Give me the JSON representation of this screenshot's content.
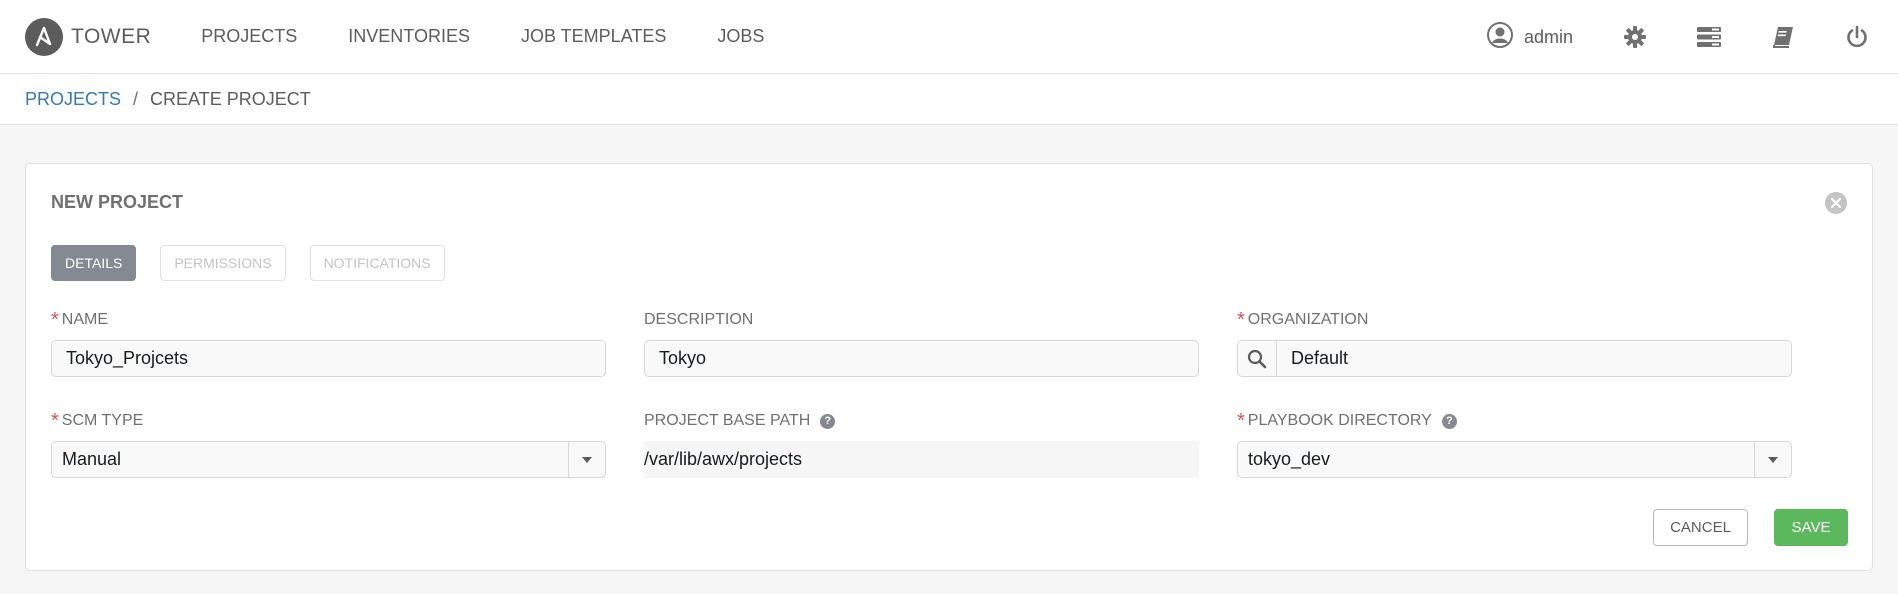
{
  "brand": {
    "name": "TOWER"
  },
  "nav": {
    "links": [
      "PROJECTS",
      "INVENTORIES",
      "JOB TEMPLATES",
      "JOBS"
    ],
    "user": "admin",
    "icons": [
      "settings-gear-icon",
      "server-list-icon",
      "book-icon",
      "power-icon"
    ]
  },
  "breadcrumb": {
    "parent": "PROJECTS",
    "separator": "/",
    "current": "CREATE PROJECT"
  },
  "panel": {
    "title": "NEW PROJECT",
    "tabs": [
      "DETAILS",
      "PERMISSIONS",
      "NOTIFICATIONS"
    ],
    "active_tab": "DETAILS"
  },
  "form": {
    "name": {
      "label": "NAME",
      "required": true,
      "value": "Tokyo_Projcets"
    },
    "description": {
      "label": "DESCRIPTION",
      "required": false,
      "value": "Tokyo"
    },
    "organization": {
      "label": "ORGANIZATION",
      "required": true,
      "value": "Default"
    },
    "scm_type": {
      "label": "SCM TYPE",
      "required": true,
      "value": "Manual"
    },
    "base_path": {
      "label": "PROJECT BASE PATH",
      "value": "/var/lib/awx/projects"
    },
    "playbook_dir": {
      "label": "PLAYBOOK DIRECTORY",
      "required": true,
      "value": "tokyo_dev"
    }
  },
  "buttons": {
    "cancel": "CANCEL",
    "save": "SAVE"
  },
  "colors": {
    "accent_link": "#337ab7",
    "save_green": "#5cb85c",
    "required_red": "#d9534f",
    "active_tab": "#848992"
  }
}
